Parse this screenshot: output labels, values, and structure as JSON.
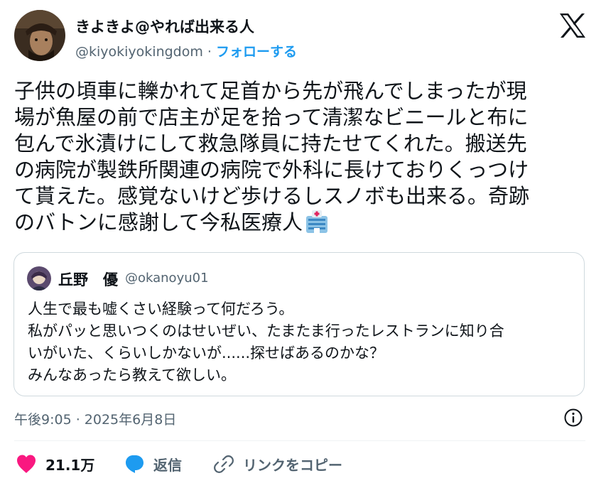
{
  "author": {
    "display_name": "きよきよ@やれば出来る人",
    "handle": "@kiyokiyokingdom",
    "separator": " · ",
    "follow_label": "フォローする"
  },
  "tweet": {
    "text": "子供の頃車に轢かれて足首から先が飛んでしまったが現\n場が魚屋の前で店主が足を拾って清潔なビニールと布に\n包んで氷漬けにして救急隊員に持たせてくれた。搬送先\nの病院が製鉄所関連の病院で外科に長けておりくっつけ\nて貰えた。感覚ないけど歩けるしスノボも出来る。奇跡\nのバトンに感謝して今私医療人"
  },
  "quote": {
    "display_name": "丘野　優",
    "handle": "@okanoyu01",
    "text": "人生で最も嘘くさい経験って何だろう。\n私がパッと思いつくのはせいぜい、たまたま行ったレストランに知り合\nいがいた、くらいしかないが......探せばあるのかな？\nみんなあったら教えて欲しい。"
  },
  "timestamp": "午後9:05 · 2025年6月8日",
  "actions": {
    "like_count": "21.1万",
    "reply_label": "返信",
    "copy_link_label": "リンクをコピー"
  },
  "colors": {
    "accent": "#1d9bf0",
    "like": "#f91880",
    "secondary_text": "#536471",
    "border": "#cfd9de"
  },
  "icons": [
    "avatar",
    "x-logo-icon",
    "hospital-emoji-icon",
    "info-icon",
    "heart-icon",
    "reply-bubble-icon",
    "link-icon"
  ]
}
